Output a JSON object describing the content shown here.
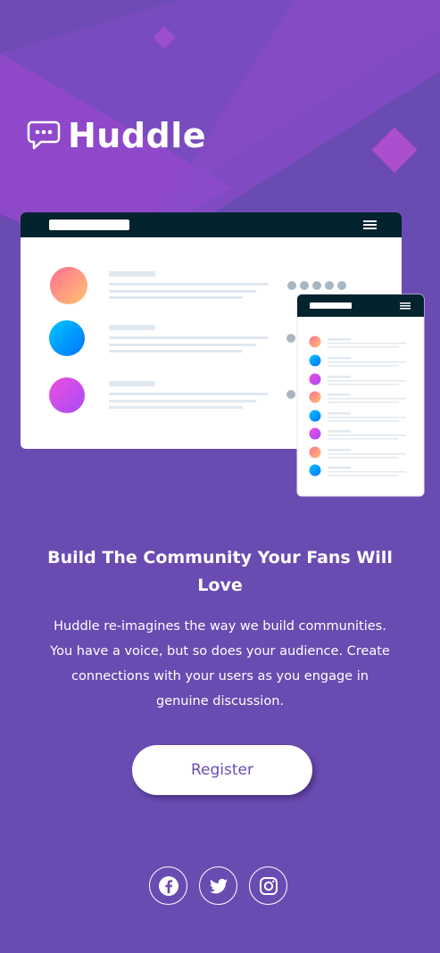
{
  "brand": {
    "name": "Huddle",
    "logo_icon": "chat-bubble-icon"
  },
  "hero": {
    "illustration": "app-mockup-illustration",
    "headline": "Build The Community Your Fans Will Love",
    "description": "Huddle re-imagines the way we build communities. You have a voice, but so does your audience. Create connections with your users as you engage in genuine discussion.",
    "cta_label": "Register"
  },
  "social": [
    {
      "icon": "facebook-icon"
    },
    {
      "icon": "twitter-icon"
    },
    {
      "icon": "instagram-icon"
    }
  ],
  "colors": {
    "background": "#6a4bb1",
    "accent_purple": "#8e4fd0",
    "mockup_header": "#03232f",
    "white": "#ffffff"
  }
}
